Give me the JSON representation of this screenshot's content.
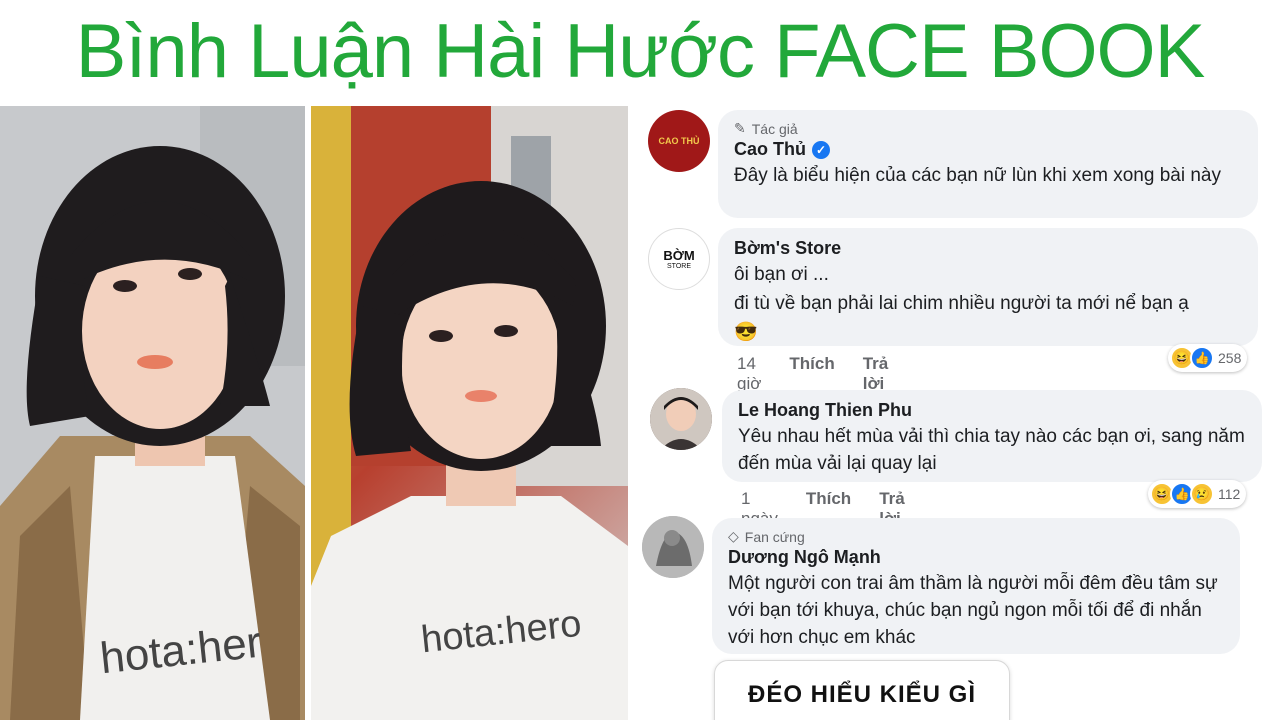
{
  "title": "Bình Luận Hài Hước FACE BOOK",
  "photos": {
    "left_shirt_text": "hota:her",
    "right_shirt_text": "hota:hero"
  },
  "comments": [
    {
      "badge": "Tác giả",
      "badge_icon": "pencil-icon",
      "name": "Cao Thủ",
      "verified": true,
      "avatar_label": "CAO THỦ",
      "text": "Đây là biểu hiện của các bạn nữ lùn khi xem xong bài này"
    },
    {
      "name": "Bờm's Store",
      "avatar_label": "BỜM",
      "avatar_sublabel": "STORE",
      "line1": "ôi bạn ơi ...",
      "line2": "đi tù về bạn phải lai chim nhiều người ta mới nể bạn ạ",
      "emoji": "😎",
      "time": "14 giờ",
      "like": "Thích",
      "reply": "Trả lời",
      "reaction_count": "258",
      "reactions": [
        "haha",
        "like"
      ]
    },
    {
      "name": "Le Hoang Thien Phu",
      "text": "Yêu nhau hết mùa vải thì chia tay nào các bạn ơi, sang năm đến mùa vải lại quay lại",
      "time": "1 ngày",
      "like": "Thích",
      "reply": "Trả lời",
      "reaction_count": "112",
      "reactions": [
        "haha",
        "like",
        "sad"
      ]
    },
    {
      "badge": "Fan cứng",
      "badge_icon": "diamond-icon",
      "name": "Dương Ngô Mạnh",
      "text": "Một người con trai âm thầm là người mỗi đêm đều tâm sự với bạn tới khuya, chúc bạn ngủ ngon mỗi tối để đi nhắn với hơn chục em khác"
    }
  ],
  "card": {
    "text": "ĐÉO HIỂU KIỂU GÌ"
  },
  "colors": {
    "title": "#22a83a",
    "bubble": "#f0f2f5",
    "like_blue": "#1877f2"
  }
}
